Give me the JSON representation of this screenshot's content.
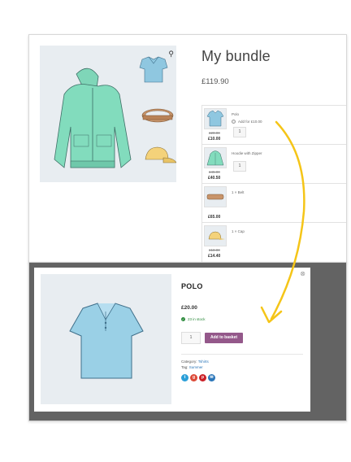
{
  "bundle_page": {
    "title": "My bundle",
    "price": "£119.90",
    "items": [
      {
        "name": "Polo",
        "optional_label": "Add for £10.00",
        "old_price": "£20.00",
        "new_price": "£10.00",
        "qty": "1"
      },
      {
        "name": "Hoodie with Zipper",
        "old_price": "£45.00",
        "new_price": "£40.50",
        "qty": "1"
      },
      {
        "name": "1 × Belt",
        "new_price": "£65.00"
      },
      {
        "name": "1 × Cap",
        "old_price": "£18.00",
        "new_price": "£14.40"
      }
    ]
  },
  "quick_view": {
    "title": "POLO",
    "price": "£20.00",
    "stock": "23 in stock",
    "qty": "1",
    "add_button": "Add to basket",
    "category_label": "Category:",
    "category_value": "Tshirts",
    "tag_label": "Tag:",
    "tag_value": "Summer"
  },
  "icons": {
    "zoom": "magnifier-icon",
    "close": "close-icon",
    "share": [
      "twitter-icon",
      "google-plus-icon",
      "pinterest-icon",
      "email-icon"
    ]
  },
  "colors": {
    "accent_button": "#94588a",
    "stock_green": "#2c8a3c",
    "arrow": "#f5c518",
    "overlay": "#636363",
    "product_image_bg": "#e8edf1"
  }
}
